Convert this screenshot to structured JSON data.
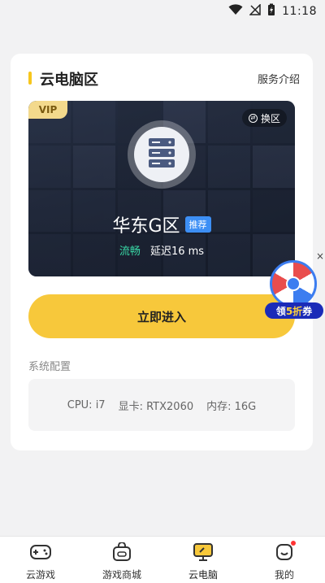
{
  "status_bar": {
    "time": "11:18"
  },
  "card": {
    "title": "云电脑区",
    "service_link": "服务介绍"
  },
  "banner": {
    "vip_label": "VIP",
    "switch_label": "换区",
    "region_name": "华东G区",
    "recommend_badge": "推荐",
    "quality": "流畅",
    "latency": "延迟16 ms"
  },
  "enter_button": "立即进入",
  "config": {
    "label": "系统配置",
    "cpu": "CPU: i7",
    "gpu": "显卡: RTX2060",
    "memory": "内存: 16G"
  },
  "promo": {
    "label_prefix": "领",
    "label_highlight": "5折",
    "label_suffix": "券",
    "close": "×"
  },
  "bottom_nav": [
    {
      "label": "云游戏",
      "icon": "gamepad-icon"
    },
    {
      "label": "游戏商城",
      "icon": "store-icon"
    },
    {
      "label": "云电脑",
      "icon": "monitor-icon",
      "active": true
    },
    {
      "label": "我的",
      "icon": "profile-icon",
      "badge_dot": true
    }
  ],
  "colors": {
    "accent": "#f7c83b",
    "recommend": "#3d8ff5",
    "smooth": "#39d9a6",
    "promo": "#1b2bb8"
  }
}
